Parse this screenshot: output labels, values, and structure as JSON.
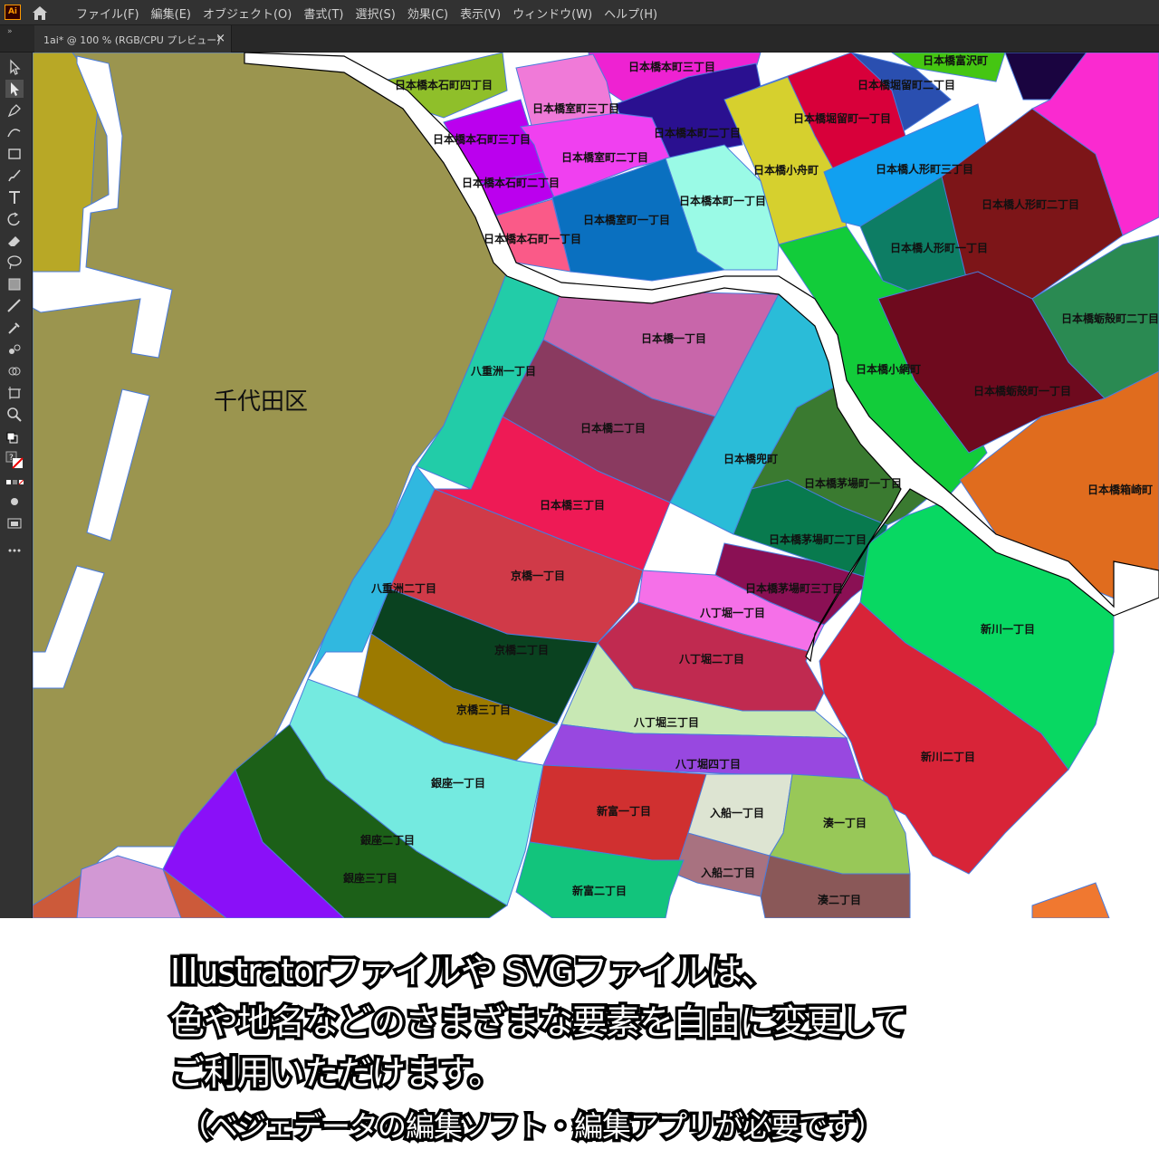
{
  "app": {
    "logo": "Ai",
    "home_icon": "home-icon"
  },
  "menu": [
    "ファイル(F)",
    "編集(E)",
    "オブジェクト(O)",
    "書式(T)",
    "選択(S)",
    "効果(C)",
    "表示(V)",
    "ウィンドウ(W)",
    "ヘルプ(H)"
  ],
  "tab": {
    "title": "1ai* @ 100 % (RGB/CPU プレビュー)",
    "close": "×"
  },
  "tools": [
    "selection-tool-icon",
    "direct-selection-tool-icon",
    "pen-tool-icon",
    "curvature-tool-icon",
    "rectangle-tool-icon",
    "paintbrush-tool-icon",
    "type-tool-icon",
    "rotate-tool-icon",
    "eraser-tool-icon",
    "lasso-tool-icon",
    "gradient-tool-icon",
    "measure-tool-icon",
    "eyedropper-tool-icon",
    "blend-tool-icon",
    "shape-builder-tool-icon",
    "artboard-tool-icon",
    "zoom-tool-icon"
  ],
  "map": {
    "district_label": "千代田区",
    "areas": [
      {
        "name": "日本橋本石町四丁目",
        "color": "#8fbf2a"
      },
      {
        "name": "日本橋本町三丁目",
        "color": "#ee22d2"
      },
      {
        "name": "日本橋富沢町",
        "color": "#45c612"
      },
      {
        "name": "日本橋堀留町二丁目",
        "color": "#2a4fb0"
      },
      {
        "name": "日本橋室町三丁目",
        "color": "#f07ad8"
      },
      {
        "name": "日本橋本石町三丁目",
        "color": "#bb00ee"
      },
      {
        "name": "日本橋本町二丁目",
        "color": "#2a1090"
      },
      {
        "name": "日本橋堀留町一丁目",
        "color": "#d8003a"
      },
      {
        "name": "日本橋室町二丁目",
        "color": "#f040f0"
      },
      {
        "name": "日本橋小舟町",
        "color": "#d6d02e"
      },
      {
        "name": "日本橋人形町三丁目",
        "color": "#11a0f0"
      },
      {
        "name": "日本橋本石町二丁目",
        "color": "#bb00ee"
      },
      {
        "name": "日本橋本町一丁目",
        "color": "#9afae6"
      },
      {
        "name": "日本橋室町一丁目",
        "color": "#0a70c0"
      },
      {
        "name": "日本橋人形町二丁目",
        "color": "#7d1518"
      },
      {
        "name": "日本橋本石町一丁目",
        "color": "#fa5a88"
      },
      {
        "name": "日本橋人形町一丁目",
        "color": "#0d7d64"
      },
      {
        "name": "日本橋蛎殻町二丁目",
        "color": "#2a8a52"
      },
      {
        "name": "日本橋一丁目",
        "color": "#c866aa"
      },
      {
        "name": "日本橋小網町",
        "color": "#12cc3a"
      },
      {
        "name": "八重洲一丁目",
        "color": "#22cca8"
      },
      {
        "name": "日本橋蛎殻町一丁目",
        "color": "#6e0a1e"
      },
      {
        "name": "日本橋二丁目",
        "color": "#8a3a60"
      },
      {
        "name": "日本橋兜町",
        "color": "#2abcd8"
      },
      {
        "name": "日本橋茅場町一丁目",
        "color": "#3a7a30"
      },
      {
        "name": "日本橋箱崎町",
        "color": "#e06c1e"
      },
      {
        "name": "日本橋三丁目",
        "color": "#ee1a55"
      },
      {
        "name": "日本橋茅場町二丁目",
        "color": "#087a4e"
      },
      {
        "name": "京橋一丁目",
        "color": "#d03a48"
      },
      {
        "name": "日本橋茅場町三丁目",
        "color": "#8a1054"
      },
      {
        "name": "八重洲二丁目",
        "color": "#30b8e0"
      },
      {
        "name": "八丁堀一丁目",
        "color": "#f570e8"
      },
      {
        "name": "新川一丁目",
        "color": "#08d862"
      },
      {
        "name": "京橋二丁目",
        "color": "#0a4220"
      },
      {
        "name": "八丁堀二丁目",
        "color": "#c02a50"
      },
      {
        "name": "京橋三丁目",
        "color": "#9c7a00"
      },
      {
        "name": "八丁堀三丁目",
        "color": "#c8e8b4"
      },
      {
        "name": "新川二丁目",
        "color": "#d82438"
      },
      {
        "name": "八丁堀四丁目",
        "color": "#9848e0"
      },
      {
        "name": "銀座一丁目",
        "color": "#74eae0"
      },
      {
        "name": "新富一丁目",
        "color": "#d03030"
      },
      {
        "name": "入船一丁目",
        "color": "#dde4d2"
      },
      {
        "name": "湊一丁目",
        "color": "#98c858"
      },
      {
        "name": "銀座二丁目",
        "color": "#1c6018"
      },
      {
        "name": "入船二丁目",
        "color": "#a87280"
      },
      {
        "name": "銀座三丁目",
        "color": "#8a10f8"
      },
      {
        "name": "新富二丁目",
        "color": "#12c47c"
      },
      {
        "name": "湊二丁目",
        "color": "#8a5858"
      }
    ]
  },
  "caption": {
    "line1": "Illustratorファイルや SVGファイルは、",
    "line2": "色や地名などのさまざまな要素を自由に変更して",
    "line3": "ご利用いただけます。",
    "line4": "（ベジェデータの編集ソフト・編集アプリが必要です）"
  },
  "colors": {
    "ui_dark": "#323232",
    "selection_blue": "#4a7bdc",
    "chiyoda_fill": "#9b954f",
    "river": "#ffffff"
  }
}
